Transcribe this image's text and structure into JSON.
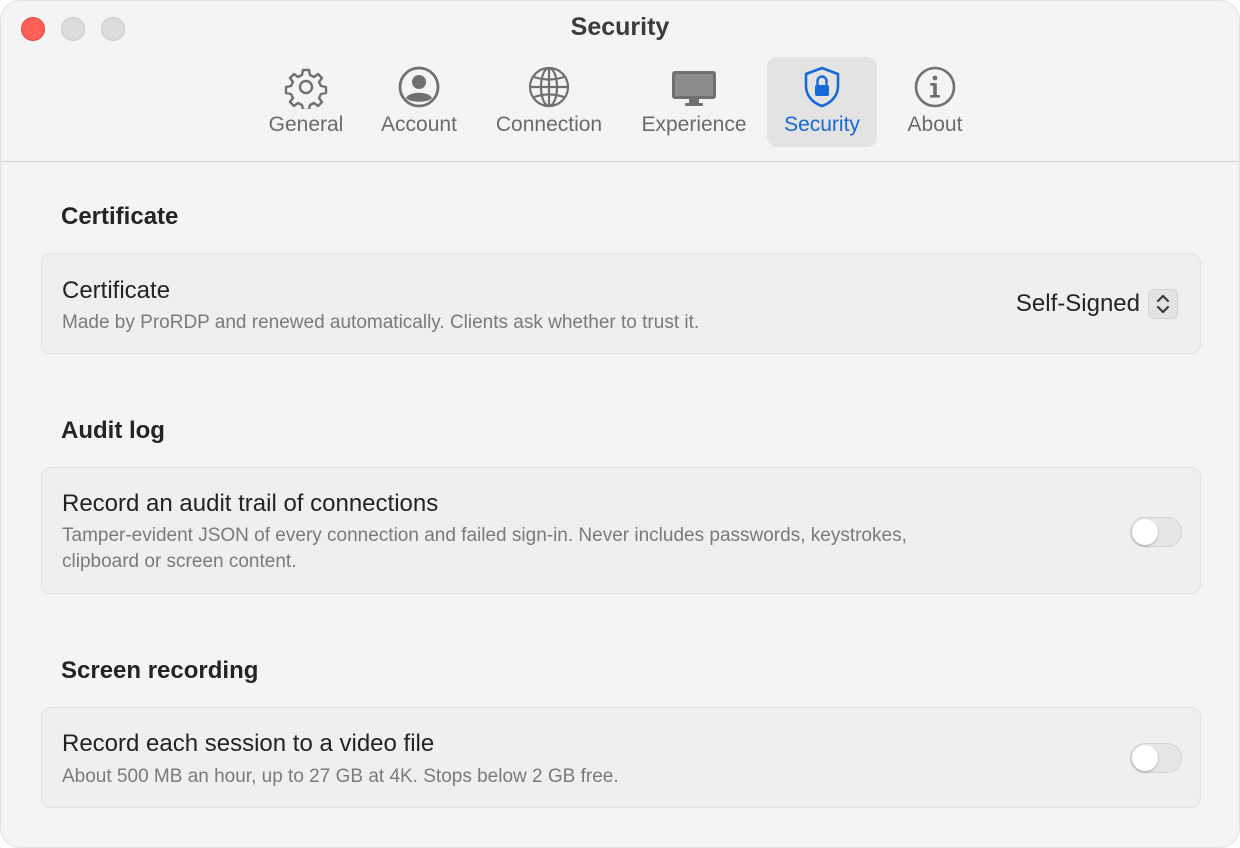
{
  "window": {
    "title": "Security"
  },
  "tabs": [
    {
      "label": "General",
      "icon": "gear-icon"
    },
    {
      "label": "Account",
      "icon": "person-circle-icon"
    },
    {
      "label": "Connection",
      "icon": "globe-icon"
    },
    {
      "label": "Experience",
      "icon": "display-icon"
    },
    {
      "label": "Security",
      "icon": "shield-lock-icon",
      "active": true
    },
    {
      "label": "About",
      "icon": "info-icon"
    }
  ],
  "colors": {
    "accent": "#1769d6",
    "close": "#fe5f57"
  },
  "sections": {
    "certificate": {
      "heading": "Certificate",
      "title": "Certificate",
      "description": "Made by ProRDP and renewed automatically. Clients ask whether to trust it.",
      "selected": "Self-Signed"
    },
    "audit": {
      "heading": "Audit log",
      "title": "Record an audit trail of connections",
      "description_line1": "Tamper-evident JSON of every connection and failed sign-in. Never includes passwords, keystrokes,",
      "description_line2": "clipboard or screen content.",
      "enabled": false
    },
    "recording": {
      "heading": "Screen recording",
      "title": "Record each session to a video file",
      "description": "About 500 MB an hour, up to 27 GB at 4K. Stops below 2 GB free.",
      "enabled": false
    }
  }
}
